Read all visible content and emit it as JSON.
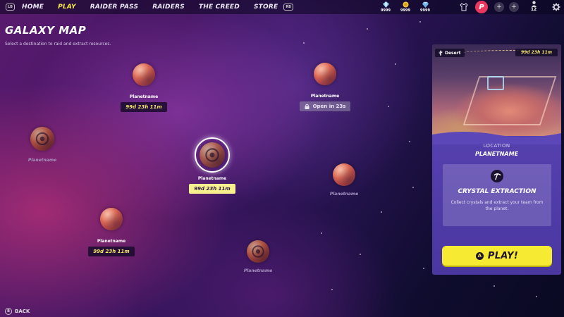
{
  "nav": {
    "left_bumper": "LB",
    "right_bumper": "RB",
    "items": [
      {
        "label": "HOME",
        "active": false
      },
      {
        "label": "PLAY",
        "active": true
      },
      {
        "label": "RAIDER PASS",
        "active": false
      },
      {
        "label": "RAIDERS",
        "active": false
      },
      {
        "label": "THE CREED",
        "active": false
      },
      {
        "label": "STORE",
        "active": false
      }
    ]
  },
  "resources": [
    {
      "icon": "crystal-icon",
      "value": "9999"
    },
    {
      "icon": "coin-icon",
      "value": "9999"
    },
    {
      "icon": "gem-icon",
      "value": "9999"
    }
  ],
  "profile": {
    "level": "12",
    "plus_1": "+",
    "plus_2": "+",
    "badge_letter": "P"
  },
  "header": {
    "title": "GALAXY MAP",
    "subtitle": "Select a destination to raid and extract resources."
  },
  "planets": [
    {
      "name": "Planetname",
      "timer": "99d 23h 11m",
      "state": "available"
    },
    {
      "name": "Planetname",
      "timer": "Open in 23s",
      "state": "locked"
    },
    {
      "name": "Planetname",
      "timer": "",
      "state": "dim"
    },
    {
      "name": "Planetname",
      "timer": "99d 23h 11m",
      "state": "selected"
    },
    {
      "name": "Planetname",
      "timer": "",
      "state": "dim"
    },
    {
      "name": "Planetname",
      "timer": "99d 23h 11m",
      "state": "available"
    },
    {
      "name": "Planetname",
      "timer": "",
      "state": "dim"
    }
  ],
  "panel": {
    "biome": "Desert",
    "timer": "99d 23h 11m",
    "location_label": "LOCATION",
    "location_name": "PLANETNAME",
    "mode_title": "CRYSTAL EXTRACTION",
    "mode_description": "Collect crystals and extract your team from the planet.",
    "play_badge": "A",
    "play_label": "PLAY!"
  },
  "back": {
    "badge": "B",
    "label": "BACK"
  },
  "colors": {
    "accent_yellow": "#f7ea33",
    "panel_purple": "#5c47b8",
    "timer_text": "#f5e66b"
  }
}
